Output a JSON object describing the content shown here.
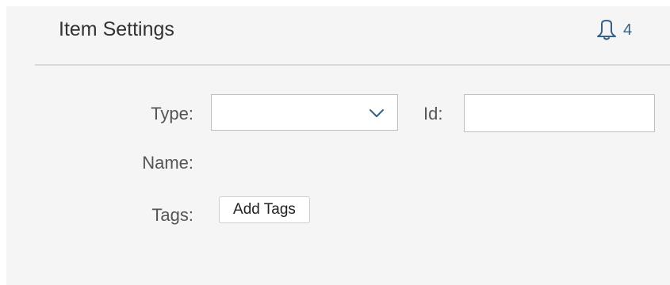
{
  "header": {
    "title": "Item Settings",
    "notifications": {
      "icon": "bell-icon",
      "count": "4",
      "color": "#346187"
    }
  },
  "form": {
    "type": {
      "label": "Type:",
      "value": "",
      "icon": "chevron-down-icon"
    },
    "id": {
      "label": "Id:",
      "value": "",
      "placeholder": ""
    },
    "name": {
      "label": "Name:",
      "value": ""
    },
    "tags": {
      "label": "Tags:",
      "button_label": "Add Tags"
    }
  }
}
